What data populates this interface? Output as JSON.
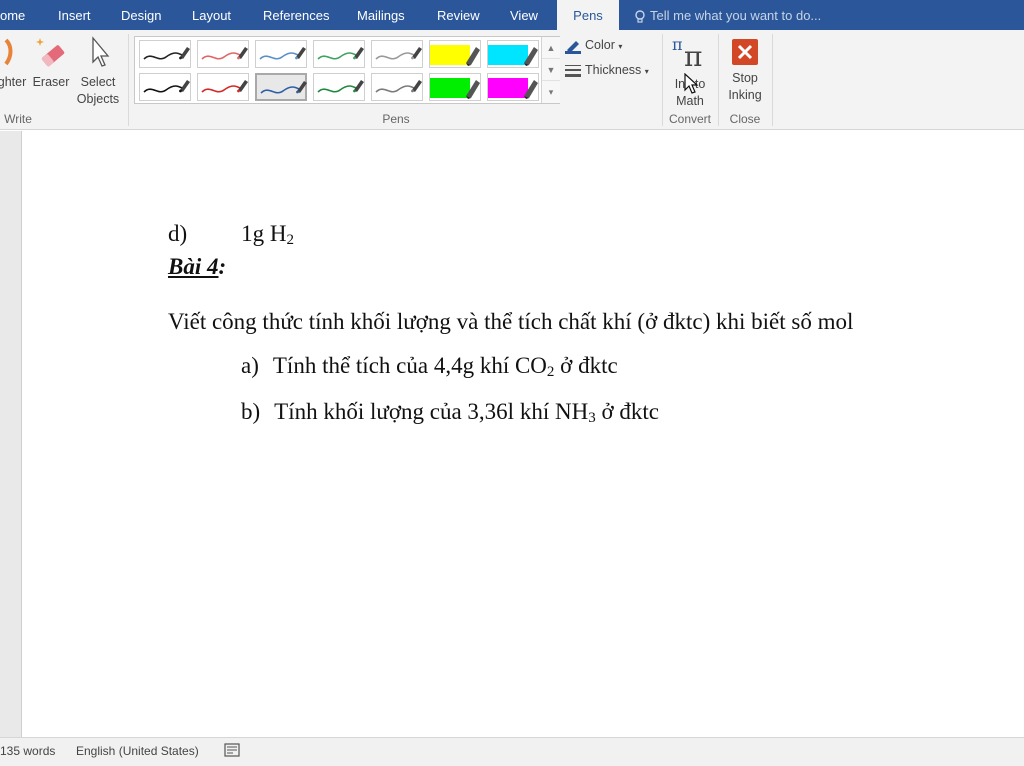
{
  "tabs": [
    {
      "label": "ome"
    },
    {
      "label": "Insert"
    },
    {
      "label": "Design"
    },
    {
      "label": "Layout"
    },
    {
      "label": "References"
    },
    {
      "label": "Mailings"
    },
    {
      "label": "Review"
    },
    {
      "label": "View"
    },
    {
      "label": "Pens",
      "active": true
    }
  ],
  "tell_me": {
    "placeholder": "Tell me what you want to do...",
    "icon": "lightbulb-icon"
  },
  "ribbon": {
    "write_group": {
      "label": "Write",
      "highlighter": "ghter",
      "eraser": "Eraser",
      "select_objects": [
        "Select",
        "Objects"
      ]
    },
    "pens_group": {
      "label": "Pens",
      "pens": [
        {
          "kind": "pen",
          "color": "#222222"
        },
        {
          "kind": "pen",
          "color": "#e06666"
        },
        {
          "kind": "pen",
          "color": "#5b8fc9"
        },
        {
          "kind": "pen",
          "color": "#3fa35f"
        },
        {
          "kind": "pen",
          "color": "#9a9a9a"
        },
        {
          "kind": "highlighter",
          "color": "#ffff00"
        },
        {
          "kind": "highlighter",
          "color": "#00e5ff"
        },
        {
          "kind": "pen",
          "color": "#111111"
        },
        {
          "kind": "pen",
          "color": "#d62828"
        },
        {
          "kind": "pen",
          "color": "#2d5fa8",
          "selected": true
        },
        {
          "kind": "pen",
          "color": "#1f8a3e"
        },
        {
          "kind": "pen",
          "color": "#7a7a7a"
        },
        {
          "kind": "highlighter",
          "color": "#00ee00"
        },
        {
          "kind": "highlighter",
          "color": "#ff00ff"
        }
      ],
      "color_label": "Color",
      "thickness_label": "Thickness"
    },
    "convert_group": {
      "label": "Convert",
      "ink_to_math": [
        "Ink to",
        "Math"
      ]
    },
    "close_group": {
      "label": "Close",
      "stop_inking": [
        "Stop",
        "Inking"
      ]
    }
  },
  "document": {
    "line_d": {
      "marker": "d)",
      "text": "1g H",
      "sub": "2"
    },
    "heading": "Bài 4",
    "heading_colon": ":",
    "paragraph": "Viết công thức tính khối lượng và thể tích chất khí (ở đktc) khi biết số mol",
    "items": [
      {
        "marker": "a)",
        "text_before": "Tính thể tích của 4,4g khí CO",
        "sub": "2",
        "text_after": " ở đktc"
      },
      {
        "marker": "b)",
        "text_before": "Tính khối lượng của 3,36l khí NH",
        "sub": "3",
        "text_after": " ở đktc"
      }
    ]
  },
  "status": {
    "words": "135 words",
    "language": "English (United States)",
    "icon": "proofing-icon"
  }
}
